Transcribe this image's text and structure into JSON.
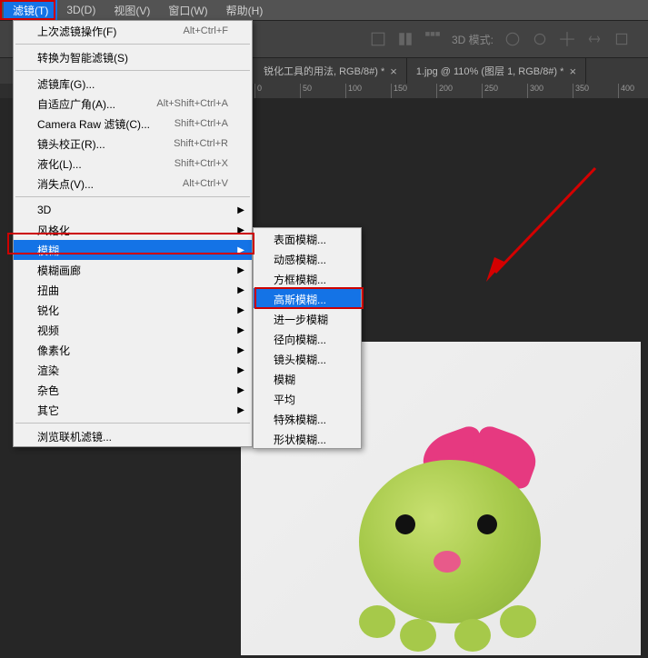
{
  "menubar": {
    "items": [
      "滤镜(T)",
      "3D(D)",
      "视图(V)",
      "窗口(W)",
      "帮助(H)"
    ]
  },
  "toolbar": {
    "mode_label": "3D 模式:"
  },
  "tabs": {
    "left": "锐化工具的用法, RGB/8#) *",
    "right": "1.jpg @ 110% (图层 1, RGB/8#) *"
  },
  "ruler": {
    "marks": [
      "0",
      "50",
      "100",
      "150",
      "200",
      "250",
      "300",
      "350",
      "400"
    ]
  },
  "dropdown": {
    "last_filter": {
      "label": "上次滤镜操作(F)",
      "shortcut": "Alt+Ctrl+F"
    },
    "smart": {
      "label": "转换为智能滤镜(S)"
    },
    "gallery": {
      "label": "滤镜库(G)..."
    },
    "adaptive": {
      "label": "自适应广角(A)...",
      "shortcut": "Alt+Shift+Ctrl+A"
    },
    "camera_raw": {
      "label": "Camera Raw 滤镜(C)...",
      "shortcut": "Shift+Ctrl+A"
    },
    "lens": {
      "label": "镜头校正(R)...",
      "shortcut": "Shift+Ctrl+R"
    },
    "liquify": {
      "label": "液化(L)...",
      "shortcut": "Shift+Ctrl+X"
    },
    "vanish": {
      "label": "消失点(V)...",
      "shortcut": "Alt+Ctrl+V"
    },
    "3d": {
      "label": "3D"
    },
    "stylize": {
      "label": "风格化"
    },
    "blur": {
      "label": "模糊"
    },
    "blur_gallery": {
      "label": "模糊画廊"
    },
    "distort": {
      "label": "扭曲"
    },
    "sharpen": {
      "label": "锐化"
    },
    "video": {
      "label": "视频"
    },
    "pixelate": {
      "label": "像素化"
    },
    "render": {
      "label": "渲染"
    },
    "noise": {
      "label": "杂色"
    },
    "other": {
      "label": "其它"
    },
    "browse": {
      "label": "浏览联机滤镜..."
    }
  },
  "submenu": {
    "surface": "表面模糊...",
    "motion": "动感模糊...",
    "box": "方框模糊...",
    "gaussian": "高斯模糊...",
    "further": "进一步模糊",
    "radial": "径向模糊...",
    "lens": "镜头模糊...",
    "blur": "模糊",
    "average": "平均",
    "smart": "特殊模糊...",
    "shape": "形状模糊..."
  }
}
